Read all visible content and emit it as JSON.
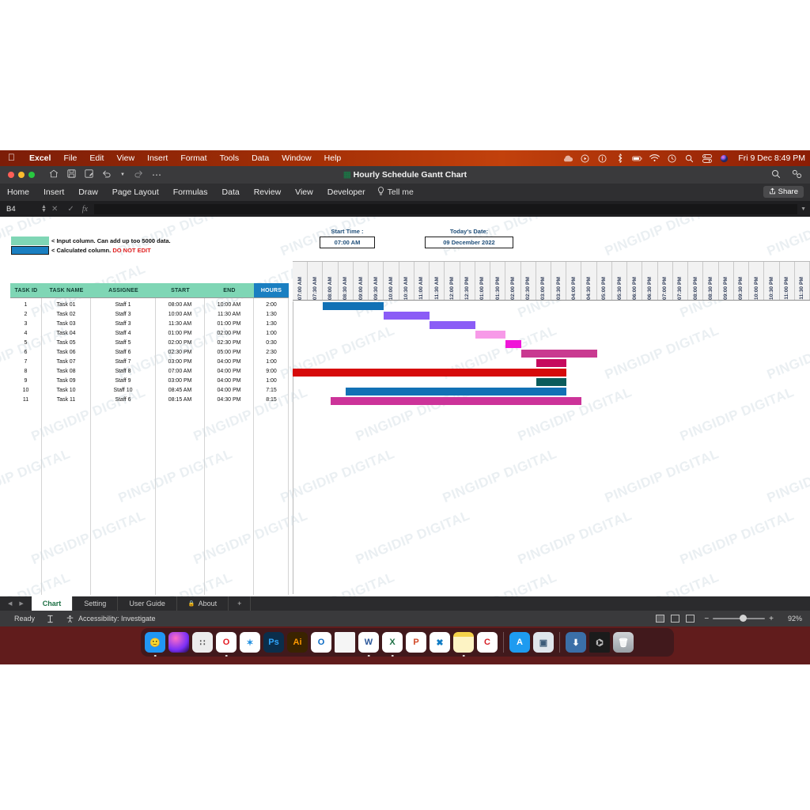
{
  "menubar": {
    "apple_icon": "apple-icon",
    "app_name": "Excel",
    "items": [
      "File",
      "Edit",
      "View",
      "Insert",
      "Format",
      "Tools",
      "Data",
      "Window",
      "Help"
    ],
    "status_icons": [
      "cloud-icon",
      "play-circle-icon",
      "info-circle-icon",
      "bluetooth-icon",
      "battery-icon",
      "wifi-icon",
      "time-machine-icon",
      "search-icon",
      "control-center-icon",
      "siri-icon"
    ],
    "clock": "Fri 9 Dec  8:49 PM"
  },
  "titlebar": {
    "document_title": "Hourly Schedule Gantt Chart",
    "quick_access": [
      "home-icon",
      "save-icon",
      "save-as-icon",
      "undo-icon",
      "undo-dropdown-icon",
      "redo-icon",
      "more-icon"
    ],
    "right_icons": [
      "search-icon",
      "collaborate-icon"
    ]
  },
  "ribbon": {
    "tabs": [
      "Home",
      "Insert",
      "Draw",
      "Page Layout",
      "Formulas",
      "Data",
      "Review",
      "View",
      "Developer"
    ],
    "tell_me": "Tell me",
    "tell_me_icon": "lightbulb-icon",
    "share_label": "Share",
    "share_icon": "share-icon"
  },
  "formula_bar": {
    "name_box": "B4",
    "cancel_icon": "cancel-icon",
    "confirm_icon": "confirm-icon",
    "fx_icon": "fx-icon",
    "formula_value": "",
    "formula_placeholder": ""
  },
  "legend": {
    "input_swatch_color": "#7fd6b5",
    "input_text": "< Input column. Can add up too 5000 data.",
    "calc_swatch_color": "#1a7fc1",
    "calc_text": "< Calculated column.",
    "calc_warning": "DO NOT EDIT"
  },
  "controls": {
    "start_time": {
      "label": "Start Time :",
      "value": "07:00 AM"
    },
    "todays_date": {
      "label": "Today's Date:",
      "value": "09 December 2022"
    }
  },
  "table": {
    "headers": [
      "TASK ID",
      "TASK NAME",
      "ASSIGNEE",
      "START",
      "END",
      "HOURS"
    ],
    "rows": [
      {
        "id": "1",
        "name": "Task 01",
        "assignee": "Staff 1",
        "start": "08:00 AM",
        "end": "10:00 AM",
        "hours": "2:00"
      },
      {
        "id": "2",
        "name": "Task 02",
        "assignee": "Staff 3",
        "start": "10:00 AM",
        "end": "11:30 AM",
        "hours": "1:30"
      },
      {
        "id": "3",
        "name": "Task 03",
        "assignee": "Staff 3",
        "start": "11:30 AM",
        "end": "01:00 PM",
        "hours": "1:30"
      },
      {
        "id": "4",
        "name": "Task 04",
        "assignee": "Staff 4",
        "start": "01:00 PM",
        "end": "02:00 PM",
        "hours": "1:00"
      },
      {
        "id": "5",
        "name": "Task 05",
        "assignee": "Staff 5",
        "start": "02:00 PM",
        "end": "02:30 PM",
        "hours": "0:30"
      },
      {
        "id": "6",
        "name": "Task 06",
        "assignee": "Staff 6",
        "start": "02:30 PM",
        "end": "05:00 PM",
        "hours": "2:30"
      },
      {
        "id": "7",
        "name": "Task 07",
        "assignee": "Staff 7",
        "start": "03:00 PM",
        "end": "04:00 PM",
        "hours": "1:00"
      },
      {
        "id": "8",
        "name": "Task 08",
        "assignee": "Staff 8",
        "start": "07:00 AM",
        "end": "04:00 PM",
        "hours": "9:00"
      },
      {
        "id": "9",
        "name": "Task 09",
        "assignee": "Staff 9",
        "start": "03:00 PM",
        "end": "04:00 PM",
        "hours": "1:00"
      },
      {
        "id": "10",
        "name": "Task 10",
        "assignee": "Staff 10",
        "start": "08:45 AM",
        "end": "04:00 PM",
        "hours": "7:15"
      },
      {
        "id": "11",
        "name": "Task 11",
        "assignee": "Staff 6",
        "start": "08:15 AM",
        "end": "04:30 PM",
        "hours": "8:15"
      }
    ]
  },
  "chart_data": {
    "type": "bar",
    "title": "Hourly Schedule Gantt Chart",
    "xlabel": "",
    "ylabel": "",
    "orientation": "horizontal",
    "grid": true,
    "legend_position": "none",
    "axis_start": "07:00 AM",
    "axis_end": "11:30 PM",
    "axis_step_minutes": 30,
    "axis_ticks": [
      "07:00 AM",
      "07:30 AM",
      "08:00 AM",
      "08:30 AM",
      "09:00 AM",
      "09:30 AM",
      "10:00 AM",
      "10:30 AM",
      "11:00 AM",
      "11:30 AM",
      "12:00 PM",
      "12:30 PM",
      "01:00 PM",
      "01:30 PM",
      "02:00 PM",
      "02:30 PM",
      "03:00 PM",
      "03:30 PM",
      "04:00 PM",
      "04:30 PM",
      "05:00 PM",
      "05:30 PM",
      "06:00 PM",
      "06:30 PM",
      "07:00 PM",
      "07:30 PM",
      "08:00 PM",
      "08:30 PM",
      "09:00 PM",
      "09:30 PM",
      "10:00 PM",
      "10:30 PM",
      "11:00 PM",
      "11:30 PM"
    ],
    "categories": [
      "Task 01",
      "Task 02",
      "Task 03",
      "Task 04",
      "Task 05",
      "Task 06",
      "Task 07",
      "Task 08",
      "Task 09",
      "Task 10",
      "Task 11"
    ],
    "bars": [
      {
        "task": "Task 01",
        "start": "08:00 AM",
        "end": "10:00 AM",
        "duration_hours": 2.0,
        "color": "#1271b5"
      },
      {
        "task": "Task 02",
        "start": "10:00 AM",
        "end": "11:30 AM",
        "duration_hours": 1.5,
        "color": "#8b5cf6"
      },
      {
        "task": "Task 03",
        "start": "11:30 AM",
        "end": "01:00 PM",
        "duration_hours": 1.5,
        "color": "#8b5cf6"
      },
      {
        "task": "Task 04",
        "start": "01:00 PM",
        "end": "02:00 PM",
        "duration_hours": 1.0,
        "color": "#f79ae8"
      },
      {
        "task": "Task 05",
        "start": "02:00 PM",
        "end": "02:30 PM",
        "duration_hours": 0.5,
        "color": "#f015d8"
      },
      {
        "task": "Task 06",
        "start": "02:30 PM",
        "end": "05:00 PM",
        "duration_hours": 2.5,
        "color": "#c93a90"
      },
      {
        "task": "Task 07",
        "start": "03:00 PM",
        "end": "04:00 PM",
        "duration_hours": 1.0,
        "color": "#c60a5e"
      },
      {
        "task": "Task 08",
        "start": "07:00 AM",
        "end": "04:00 PM",
        "duration_hours": 9.0,
        "color": "#d60b0b"
      },
      {
        "task": "Task 09",
        "start": "03:00 PM",
        "end": "04:00 PM",
        "duration_hours": 1.0,
        "color": "#0b5c5c"
      },
      {
        "task": "Task 10",
        "start": "08:45 AM",
        "end": "04:00 PM",
        "duration_hours": 7.25,
        "color": "#1271b5"
      },
      {
        "task": "Task 11",
        "start": "08:15 AM",
        "end": "04:30 PM",
        "duration_hours": 8.25,
        "color": "#cc3399"
      }
    ]
  },
  "sheet_tabs": {
    "nav_prev_icon": "prev-sheet-icon",
    "nav_next_icon": "next-sheet-icon",
    "tabs": [
      {
        "label": "Chart",
        "active": true,
        "locked": false
      },
      {
        "label": "Setting",
        "active": false,
        "locked": false
      },
      {
        "label": "User Guide",
        "active": false,
        "locked": false
      },
      {
        "label": "About",
        "active": false,
        "locked": true
      }
    ],
    "add_label": "+"
  },
  "status_bar": {
    "ready_text": "Ready",
    "accessibility_text": "Accessibility: Investigate",
    "selection_icon": "selection-icon",
    "accessibility_icon": "accessibility-icon",
    "view_modes": [
      "normal-view-icon",
      "page-layout-icon",
      "page-break-icon"
    ],
    "zoom_out_label": "−",
    "zoom_in_label": "+",
    "zoom_level": "92%"
  },
  "dock": {
    "items": [
      {
        "name": "finder",
        "glyph": "🙂",
        "bg": "#2196f3",
        "fg": "#ffffff",
        "running": true
      },
      {
        "name": "siri",
        "glyph": "",
        "bg": "radial-gradient(circle at 35% 30%, #ff6ec7, #7b2ff7 60%, #1a0a3a)",
        "fg": "#ffffff",
        "running": false
      },
      {
        "name": "launchpad",
        "glyph": "∷",
        "bg": "#ececec",
        "fg": "#555555",
        "running": false
      },
      {
        "name": "opera",
        "glyph": "O",
        "bg": "#ffffff",
        "fg": "#e41b23",
        "running": true
      },
      {
        "name": "safari",
        "glyph": "✶",
        "bg": "#ffffff",
        "fg": "#1f8fe0",
        "running": false
      },
      {
        "name": "photoshop",
        "glyph": "Ps",
        "bg": "#0b2e4b",
        "fg": "#31a8ff",
        "running": false
      },
      {
        "name": "illustrator",
        "glyph": "Ai",
        "bg": "#3a2300",
        "fg": "#ff9a00",
        "running": false
      },
      {
        "name": "outlook",
        "glyph": "O",
        "bg": "#ffffff",
        "fg": "#0a6ac4",
        "running": false
      },
      {
        "name": "pages-document",
        "glyph": "",
        "bg": "#f5f5f5",
        "fg": "#777777",
        "running": false
      },
      {
        "name": "word",
        "glyph": "W",
        "bg": "#ffffff",
        "fg": "#2b579a",
        "running": true
      },
      {
        "name": "excel",
        "glyph": "X",
        "bg": "#ffffff",
        "fg": "#1d7044",
        "running": true
      },
      {
        "name": "powerpoint",
        "glyph": "P",
        "bg": "#ffffff",
        "fg": "#d24726",
        "running": false
      },
      {
        "name": "vscode",
        "glyph": "✖",
        "bg": "#ffffff",
        "fg": "#0e7bc4",
        "running": false
      },
      {
        "name": "notes",
        "glyph": "",
        "bg": "#fdf3c4",
        "fg": "#8a7a20",
        "running": true
      },
      {
        "name": "ccleaner",
        "glyph": "C",
        "bg": "#ffffff",
        "fg": "#d61f26",
        "running": false
      },
      {
        "name": "app-store",
        "glyph": "A",
        "bg": "#1e9bf0",
        "fg": "#ffffff",
        "running": false
      },
      {
        "name": "preview",
        "glyph": "▣",
        "bg": "#dfe6ec",
        "fg": "#3b5b78",
        "running": false
      },
      {
        "name": "downloads-stack",
        "glyph": "⬇",
        "bg": "#3b6fa8",
        "fg": "#ffffff",
        "running": false
      },
      {
        "name": "terminal-window",
        "glyph": "⌬",
        "bg": "#1b1b1b",
        "fg": "#c8c8c8",
        "running": false
      },
      {
        "name": "trash",
        "glyph": "🗑",
        "bg": "#9aa0a6",
        "fg": "#ffffff",
        "running": false
      }
    ]
  },
  "watermark": {
    "text": "PINGIDIP DIGITAL",
    "color": "#c9d6de"
  }
}
